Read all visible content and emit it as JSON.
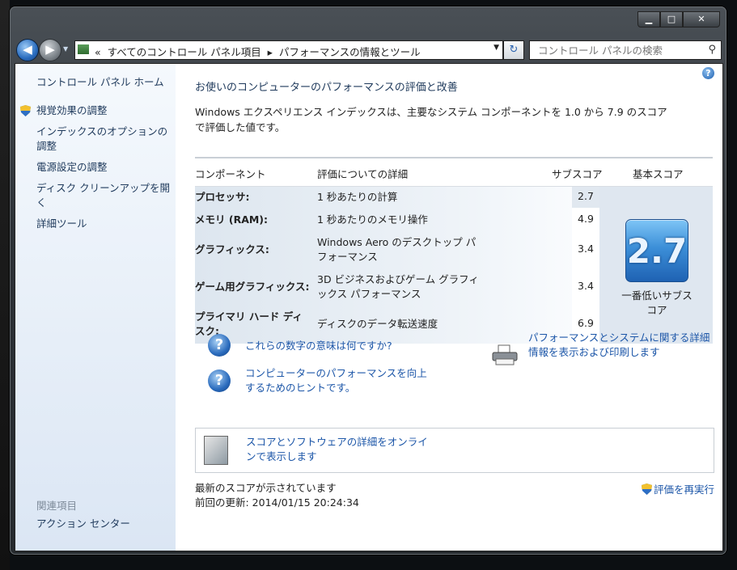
{
  "window": {
    "minimize": "▁",
    "maximize": "□",
    "close": "✕"
  },
  "address": {
    "chevron": "«",
    "crumb1": "すべてのコントロール パネル項目",
    "sep": "▸",
    "crumb2": "パフォーマンスの情報とツール"
  },
  "search": {
    "placeholder": "コントロール パネルの検索"
  },
  "sidebar": {
    "home": "コントロール パネル ホーム",
    "items": [
      {
        "label": "視覚効果の調整",
        "icon": "shield-icon"
      },
      {
        "label": "インデックスのオプションの調整"
      },
      {
        "label": "電源設定の調整"
      },
      {
        "label": "ディスク クリーンアップを開く"
      },
      {
        "label": "詳細ツール"
      }
    ],
    "related_heading": "関連項目",
    "related_items": [
      "アクション センター"
    ]
  },
  "main": {
    "heading": "お使いのコンピューターのパフォーマンスの評価と改善",
    "description": "Windows エクスペリエンス インデックスは、主要なシステム コンポーネントを 1.0 から 7.9 のスコアで評価した値です。",
    "table": {
      "headers": {
        "component": "コンポーネント",
        "details": "評価についての詳細",
        "subscore": "サブスコア",
        "base": "基本スコア"
      },
      "rows": [
        {
          "component": "プロセッサ:",
          "detail": "1 秒あたりの計算",
          "subscore": "2.7"
        },
        {
          "component": "メモリ (RAM):",
          "detail": "1 秒あたりのメモリ操作",
          "subscore": "4.9"
        },
        {
          "component": "グラフィックス:",
          "detail": "Windows Aero のデスクトップ パフォーマンス",
          "subscore": "3.4"
        },
        {
          "component": "ゲーム用グラフィックス:",
          "detail": "3D ビジネスおよびゲーム グラフィックス パフォーマンス",
          "subscore": "3.4"
        },
        {
          "component": "プライマリ ハード ディスク:",
          "detail": "ディスクのデータ転送速度",
          "subscore": "6.9"
        }
      ],
      "base_score": "2.7",
      "base_label": "一番低いサブスコア"
    },
    "links": {
      "what_numbers": "これらの数字の意味は何ですか?",
      "tips": "コンピューターのパフォーマンスを向上するためのヒントです。",
      "print_details": "パフォーマンスとシステムに関する詳細情報を表示および印刷します",
      "online": "スコアとソフトウェアの詳細をオンラインで表示します"
    },
    "status": {
      "latest": "最新のスコアが示されています",
      "last_update": "前回の更新: 2014/01/15 20:24:34",
      "rerun": "評価を再実行"
    }
  }
}
